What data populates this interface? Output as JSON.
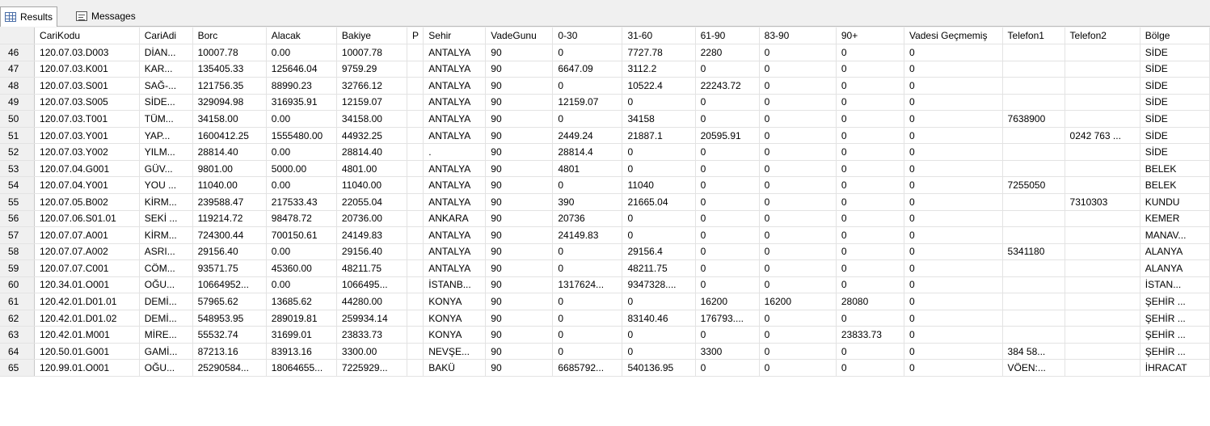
{
  "tabs": {
    "results": "Results",
    "messages": "Messages"
  },
  "columns": [
    "CariKodu",
    "CariAdi",
    "Borc",
    "Alacak",
    "Bakiye",
    "P",
    "Sehir",
    "VadeGunu",
    "0-30",
    "31-60",
    "61-90",
    "83-90",
    "90+",
    "Vadesi Geçmemiş",
    "Telefon1",
    "Telefon2",
    "Bölge"
  ],
  "rows": [
    [
      "46",
      "120.07.03.D003",
      "DİAN...",
      "10007.78",
      "0.00",
      "10007.78",
      "",
      "ANTALYA",
      "90",
      "0",
      "7727.78",
      "2280",
      "0",
      "0",
      "0",
      "",
      "",
      "SİDE"
    ],
    [
      "47",
      "120.07.03.K001",
      "KAR...",
      "135405.33",
      "125646.04",
      "9759.29",
      "",
      "ANTALYA",
      "90",
      "6647.09",
      "3112.2",
      "0",
      "0",
      "0",
      "0",
      "",
      "",
      "SİDE"
    ],
    [
      "48",
      "120.07.03.S001",
      "SAĞ-...",
      "121756.35",
      "88990.23",
      "32766.12",
      "",
      "ANTALYA",
      "90",
      "0",
      "10522.4",
      "22243.72",
      "0",
      "0",
      "0",
      "",
      "",
      "SİDE"
    ],
    [
      "49",
      "120.07.03.S005",
      "SİDE...",
      "329094.98",
      "316935.91",
      "12159.07",
      "",
      "ANTALYA",
      "90",
      "12159.07",
      "0",
      "0",
      "0",
      "0",
      "0",
      "",
      "",
      "SİDE"
    ],
    [
      "50",
      "120.07.03.T001",
      "TÜM...",
      "34158.00",
      "0.00",
      "34158.00",
      "",
      "ANTALYA",
      "90",
      "0",
      "34158",
      "0",
      "0",
      "0",
      "0",
      "7638900",
      "",
      "SİDE"
    ],
    [
      "51",
      "120.07.03.Y001",
      "YAP...",
      "1600412.25",
      "1555480.00",
      "44932.25",
      "",
      "ANTALYA",
      "90",
      "2449.24",
      "21887.1",
      "20595.91",
      "0",
      "0",
      "0",
      "",
      "0242 763 ...",
      "SİDE"
    ],
    [
      "52",
      "120.07.03.Y002",
      "YILM...",
      "28814.40",
      "0.00",
      "28814.40",
      "",
      ".",
      "90",
      "28814.4",
      "0",
      "0",
      "0",
      "0",
      "0",
      "",
      "",
      "SİDE"
    ],
    [
      "53",
      "120.07.04.G001",
      "GÜV...",
      "9801.00",
      "5000.00",
      "4801.00",
      "",
      "ANTALYA",
      "90",
      "4801",
      "0",
      "0",
      "0",
      "0",
      "0",
      "",
      "",
      "BELEK"
    ],
    [
      "54",
      "120.07.04.Y001",
      "YOU ...",
      "11040.00",
      "0.00",
      "11040.00",
      "",
      "ANTALYA",
      "90",
      "0",
      "11040",
      "0",
      "0",
      "0",
      "0",
      "7255050",
      "",
      "BELEK"
    ],
    [
      "55",
      "120.07.05.B002",
      "KİRM...",
      "239588.47",
      "217533.43",
      "22055.04",
      "",
      "ANTALYA",
      "90",
      "390",
      "21665.04",
      "0",
      "0",
      "0",
      "0",
      "",
      "7310303",
      "KUNDU"
    ],
    [
      "56",
      "120.07.06.S01.01",
      "SEKİ ...",
      "119214.72",
      "98478.72",
      "20736.00",
      "",
      "ANKARA",
      "90",
      "20736",
      "0",
      "0",
      "0",
      "0",
      "0",
      "",
      "",
      "KEMER"
    ],
    [
      "57",
      "120.07.07.A001",
      "KİRM...",
      "724300.44",
      "700150.61",
      "24149.83",
      "",
      "ANTALYA",
      "90",
      "24149.83",
      "0",
      "0",
      "0",
      "0",
      "0",
      "",
      "",
      "MANAV..."
    ],
    [
      "58",
      "120.07.07.A002",
      "ASRI...",
      "29156.40",
      "0.00",
      "29156.40",
      "",
      "ANTALYA",
      "90",
      "0",
      "29156.4",
      "0",
      "0",
      "0",
      "0",
      "5341180",
      "",
      "ALANYA"
    ],
    [
      "59",
      "120.07.07.C001",
      "CÖM...",
      "93571.75",
      "45360.00",
      "48211.75",
      "",
      "ANTALYA",
      "90",
      "0",
      "48211.75",
      "0",
      "0",
      "0",
      "0",
      "",
      "",
      "ALANYA"
    ],
    [
      "60",
      "120.34.01.O001",
      "OĞU...",
      "10664952...",
      "0.00",
      "1066495...",
      "",
      "İSTANB...",
      "90",
      "1317624...",
      "9347328....",
      "0",
      "0",
      "0",
      "0",
      "",
      "",
      "İSTAN..."
    ],
    [
      "61",
      "120.42.01.D01.01",
      "DEMİ...",
      "57965.62",
      "13685.62",
      "44280.00",
      "",
      "KONYA",
      "90",
      "0",
      "0",
      "16200",
      "16200",
      "28080",
      "0",
      "",
      "",
      "ŞEHİR ..."
    ],
    [
      "62",
      "120.42.01.D01.02",
      "DEMİ...",
      "548953.95",
      "289019.81",
      "259934.14",
      "",
      "KONYA",
      "90",
      "0",
      "83140.46",
      "176793....",
      "0",
      "0",
      "0",
      "",
      "",
      "ŞEHİR ..."
    ],
    [
      "63",
      "120.42.01.M001",
      "MİRE...",
      "55532.74",
      "31699.01",
      "23833.73",
      "",
      "KONYA",
      "90",
      "0",
      "0",
      "0",
      "0",
      "23833.73",
      "0",
      "",
      "",
      "ŞEHİR ..."
    ],
    [
      "64",
      "120.50.01.G001",
      "GAMİ...",
      "87213.16",
      "83913.16",
      "3300.00",
      "",
      "NEVŞE...",
      "90",
      "0",
      "0",
      "3300",
      "0",
      "0",
      "0",
      "384 58...",
      "",
      "ŞEHİR ..."
    ],
    [
      "65",
      "120.99.01.O001",
      "OĞU...",
      "25290584...",
      "18064655...",
      "7225929...",
      "",
      "BAKÜ",
      "90",
      "6685792...",
      "540136.95",
      "0",
      "0",
      "0",
      "0",
      "VÖEN:...",
      "",
      "İHRACAT"
    ]
  ],
  "colors": {
    "grid_line": "#e3e3e3",
    "row_header_bg": "#f0f0f0",
    "tab_bg": "#f0f0f0"
  },
  "icons": {
    "results": "grid-icon",
    "messages": "messages-icon"
  }
}
